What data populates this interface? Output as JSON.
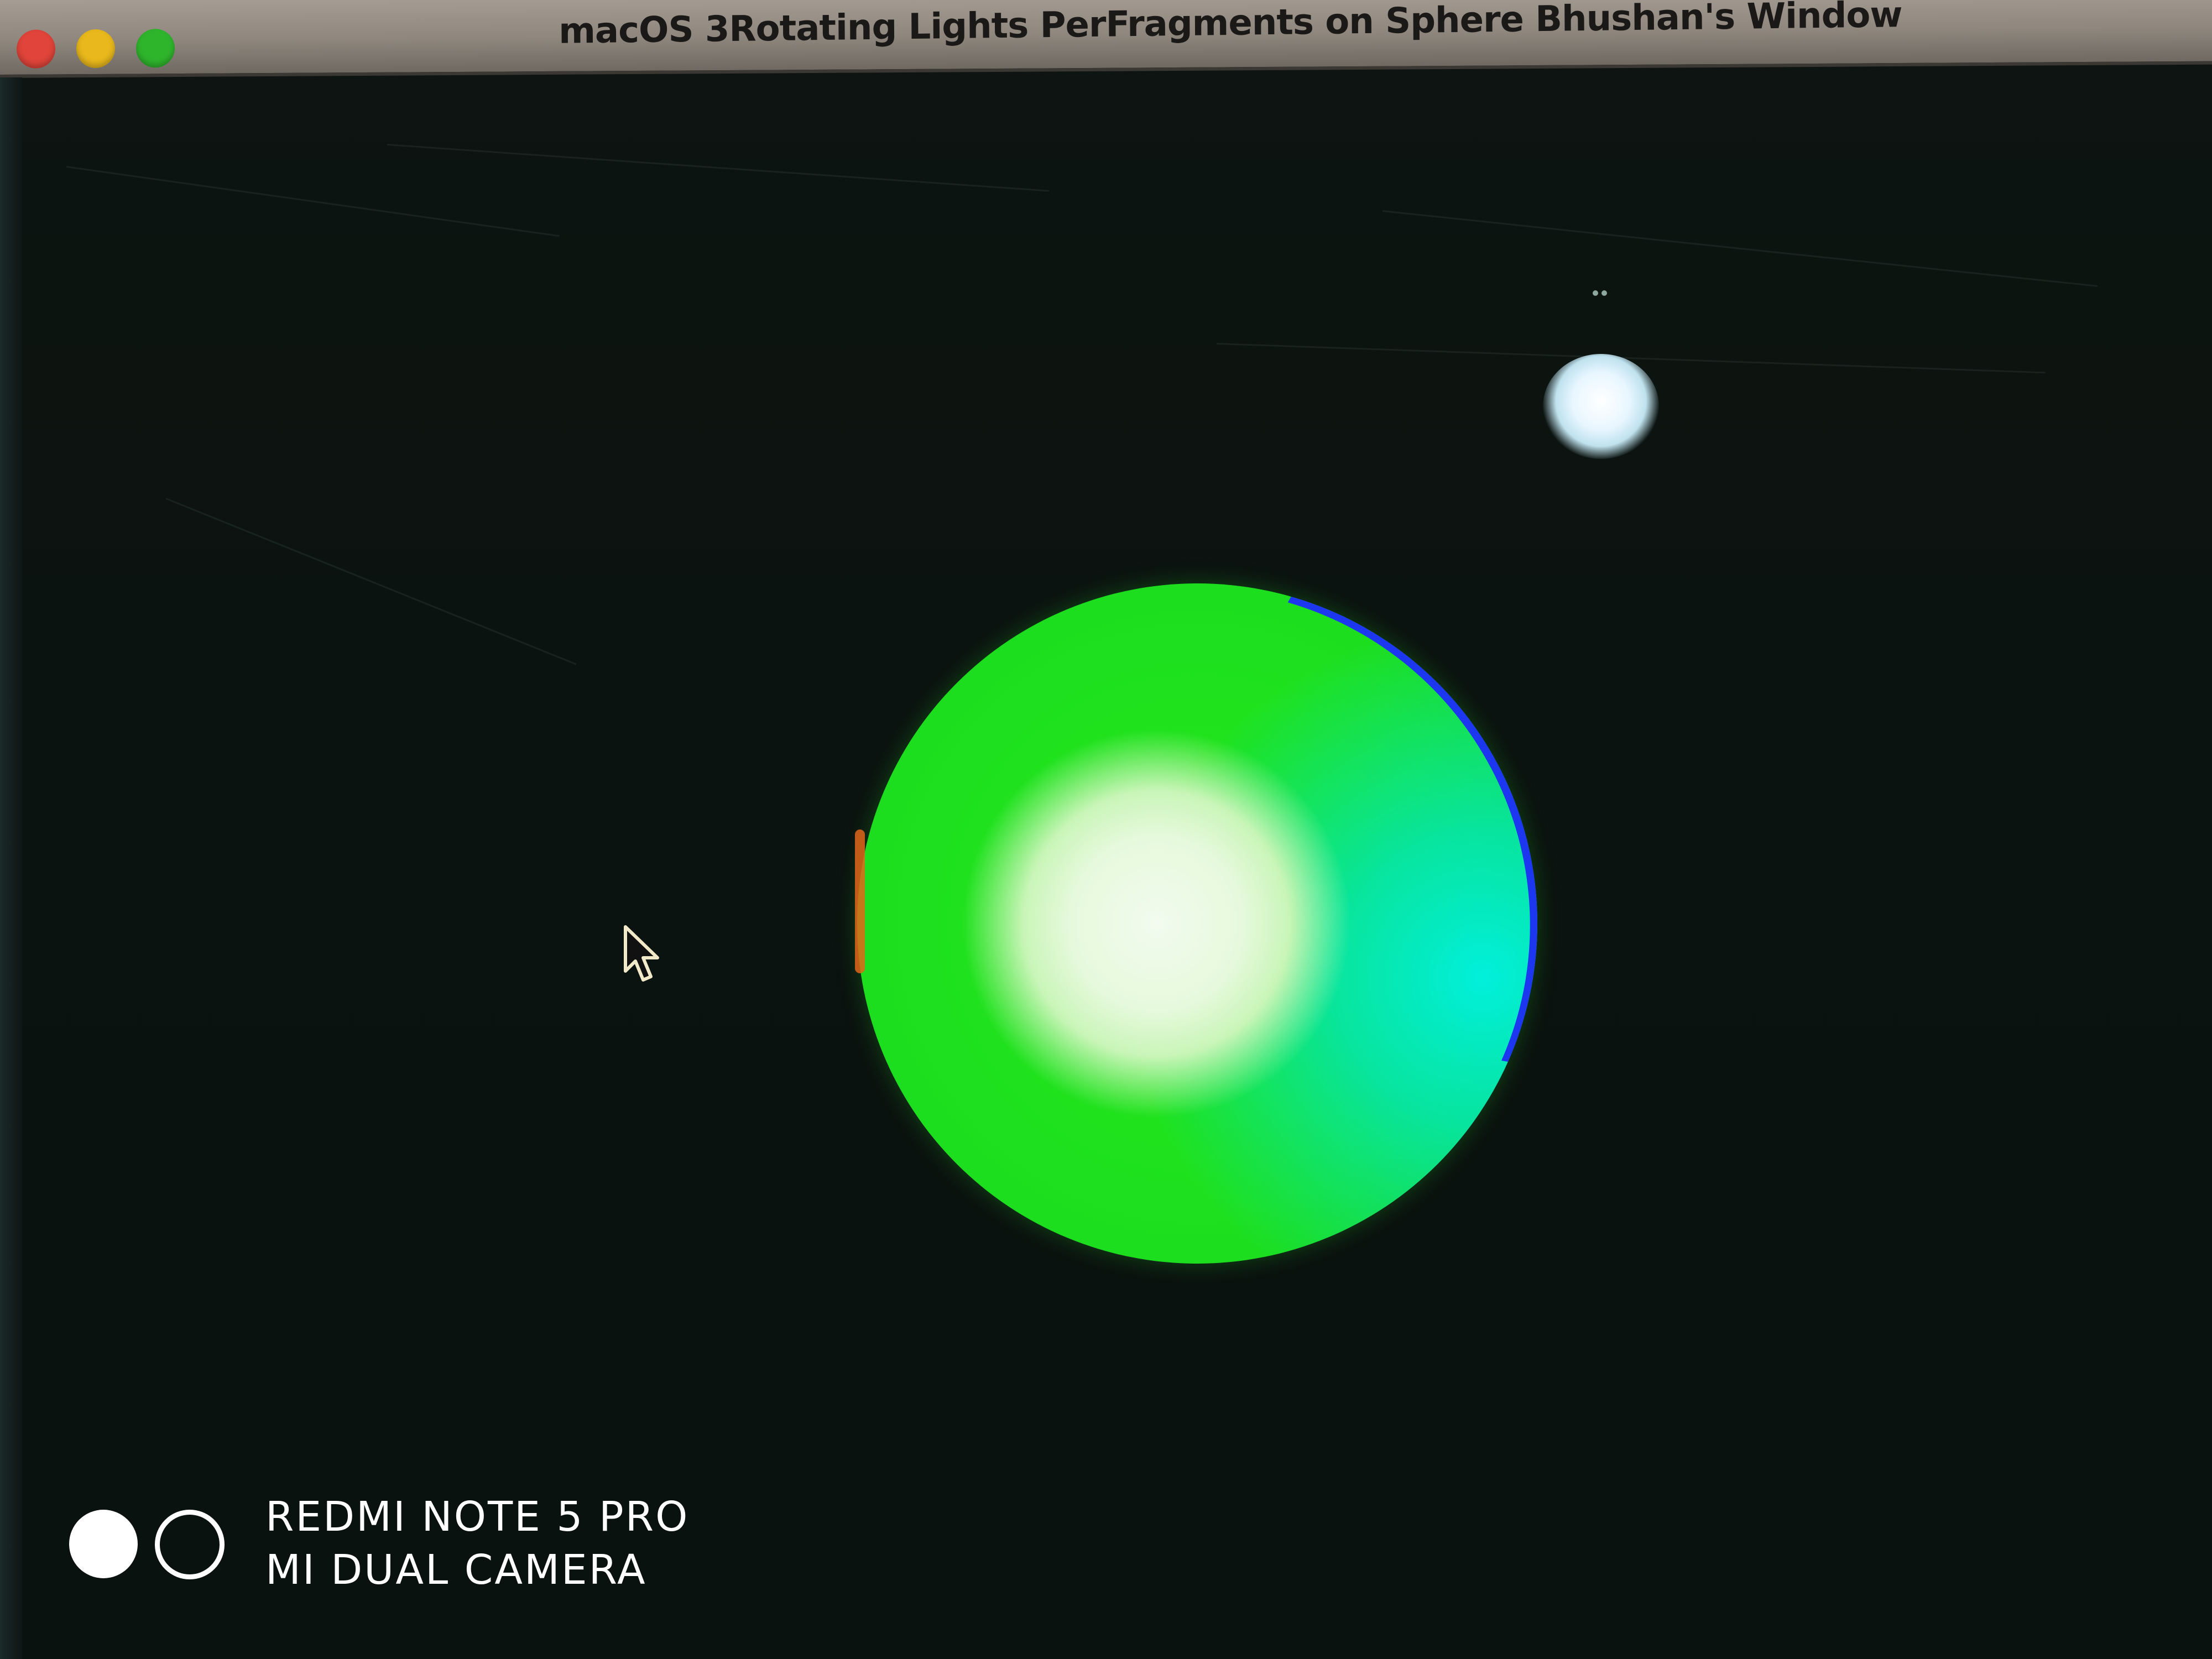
{
  "window": {
    "title": "macOS 3Rotating Lights PerFragments on Sphere Bhushan's Window",
    "traffic_lights": {
      "close_color": "#e0443a",
      "minimize_color": "#e9b81c",
      "maximize_color": "#2fb52c"
    }
  },
  "scene": {
    "background_color": "#0b120f",
    "sphere_colors": {
      "diffuse": "#1ee01e",
      "specular": "#f2fbef",
      "cyan_light": "#00e6dc",
      "blue_rim": "#1d36f0",
      "red_rim": "#e0661a"
    }
  },
  "cursor": {
    "icon": "arrow-cursor-icon"
  },
  "watermark": {
    "line1": "REDMI NOTE 5 PRO",
    "line2": "MI DUAL CAMERA"
  }
}
